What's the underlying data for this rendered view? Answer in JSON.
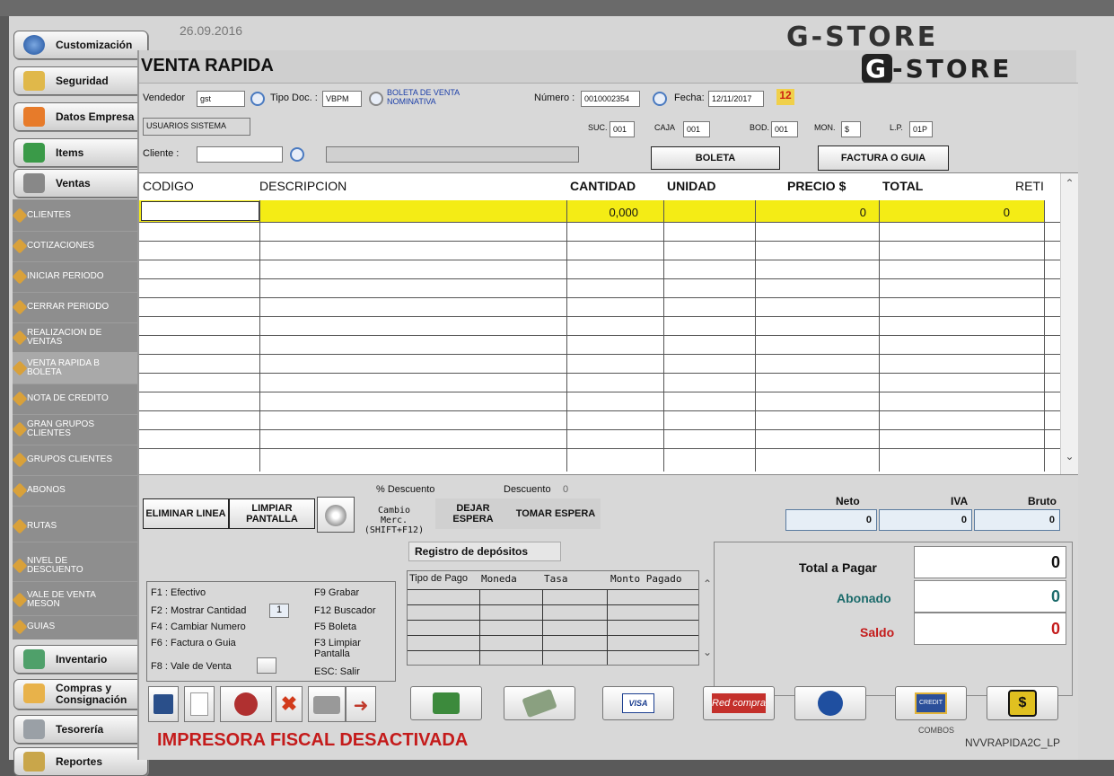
{
  "background": {
    "date": "26.09.2016",
    "logo": "G-STORE"
  },
  "sidebar": {
    "buttons": [
      {
        "label": "Customización",
        "icon": "globe-icon"
      },
      {
        "label": "Seguridad",
        "icon": "padlock-icon"
      },
      {
        "label": "Datos Empresa",
        "icon": "home-icon"
      },
      {
        "label": "Items",
        "icon": "items-icon"
      },
      {
        "label": "Ventas",
        "icon": "printer-icon"
      },
      {
        "label": "Inventario",
        "icon": "magnifier-icon"
      },
      {
        "label": "Compras y Consignación",
        "icon": "person-icon"
      },
      {
        "label": "Tesorería",
        "icon": "money-icon"
      },
      {
        "label": "Reportes",
        "icon": "report-icon"
      }
    ],
    "ventas_items": [
      "CLIENTES",
      "COTIZACIONES",
      "INICIAR PERIODO",
      "CERRAR PERIODO",
      "REALIZACION DE\nVENTAS",
      "VENTA RAPIDA B\nBOLETA",
      "NOTA DE CREDITO",
      "GRAN GRUPOS\nCLIENTES",
      "GRUPOS CLIENTES",
      "ABONOS",
      "RUTAS",
      "NIVEL DE\nDESCUENTO",
      "VALE DE VENTA\nMESON",
      "GUIAS"
    ]
  },
  "window": {
    "title": "VENTA RAPIDA",
    "logo": "G-STORE"
  },
  "header": {
    "vendedor_label": "Vendedor",
    "vendedor_value": "gst",
    "tipo_doc_label": "Tipo Doc. :",
    "tipo_doc_value": "VBPM",
    "tipo_doc_desc": "BOLETA DE VENTA NOMINATIVA",
    "numero_label": "Número :",
    "numero_value": "0010002354",
    "fecha_label": "Fecha:",
    "fecha_value": "12/11/2017",
    "usuarios_label": "USUARIOS SISTEMA",
    "suc_label": "SUC.",
    "suc_value": "001",
    "caja_label": "CAJA",
    "caja_value": "001",
    "bod_label": "BOD.",
    "bod_value": "001",
    "mon_label": "MON.",
    "mon_value": "$",
    "lp_label": "L.P.",
    "lp_value": "01P",
    "cliente_label": "Cliente :",
    "cliente_value": "",
    "boleta_btn": "BOLETA",
    "factura_btn": "FACTURA O GUIA"
  },
  "grid": {
    "columns": [
      "CODIGO",
      "DESCRIPCION",
      "CANTIDAD",
      "UNIDAD",
      "PRECIO $",
      "TOTAL",
      "RETI"
    ],
    "row1": {
      "cantidad": "0,000",
      "precio": "0",
      "total": "0"
    }
  },
  "actions": {
    "eliminar": "ELIMINAR LINEA",
    "limpiar": "LIMPIAR PANTALLA",
    "cambio": "Cambio Merc. (SHIFT+F12)",
    "dejar": "DEJAR ESPERA",
    "tomar": "TOMAR ESPERA",
    "pct_descuento_label": "% Descuento",
    "descuento_label": "Descuento",
    "descuento_value": "0",
    "neto_label": "Neto",
    "neto_value": "0",
    "iva_label": "IVA",
    "iva_value": "0",
    "bruto_label": "Bruto",
    "bruto_value": "0"
  },
  "shortcuts": {
    "f1": "F1 : Efectivo",
    "f2": "F2 : Mostrar Cantidad",
    "f2_value": "1",
    "f4": "F4 : Cambiar Numero",
    "f6": "F6 : Factura o Guia",
    "f8": "F8 : Vale de Venta",
    "f9": "F9   Grabar",
    "f12": "F12  Buscador",
    "f5": "F5   Boleta",
    "f3": "F3   Limpiar Pantalla",
    "esc": "ESC: Salir"
  },
  "deposits": {
    "tab": "Registro de depósitos",
    "columns": [
      "Tipo de Pago",
      "Moneda",
      "Tasa",
      "Monto Pagado"
    ]
  },
  "totals": {
    "total_label": "Total a Pagar",
    "total_value": "0",
    "abonado_label": "Abonado",
    "abonado_value": "0",
    "saldo_label": "Saldo",
    "saldo_value": "0"
  },
  "payment_buttons": [
    "cash-icon",
    "check-icon",
    "visa-icon",
    "redcompra-icon",
    "bank-icon",
    "credit-card-icon",
    "gs-icon"
  ],
  "payment_texts": {
    "visa": "VISA",
    "redcompra": "Red compra",
    "credit": "CREDIT",
    "combos": "COMBOS"
  },
  "status": {
    "message": "IMPRESORA FISCAL DESACTIVADA",
    "form_name": "NVVRAPIDA2C_LP"
  },
  "colors": {
    "highlight": "#f4ec15",
    "alert": "#c41b1b",
    "abonado": "#1c6b6b"
  }
}
